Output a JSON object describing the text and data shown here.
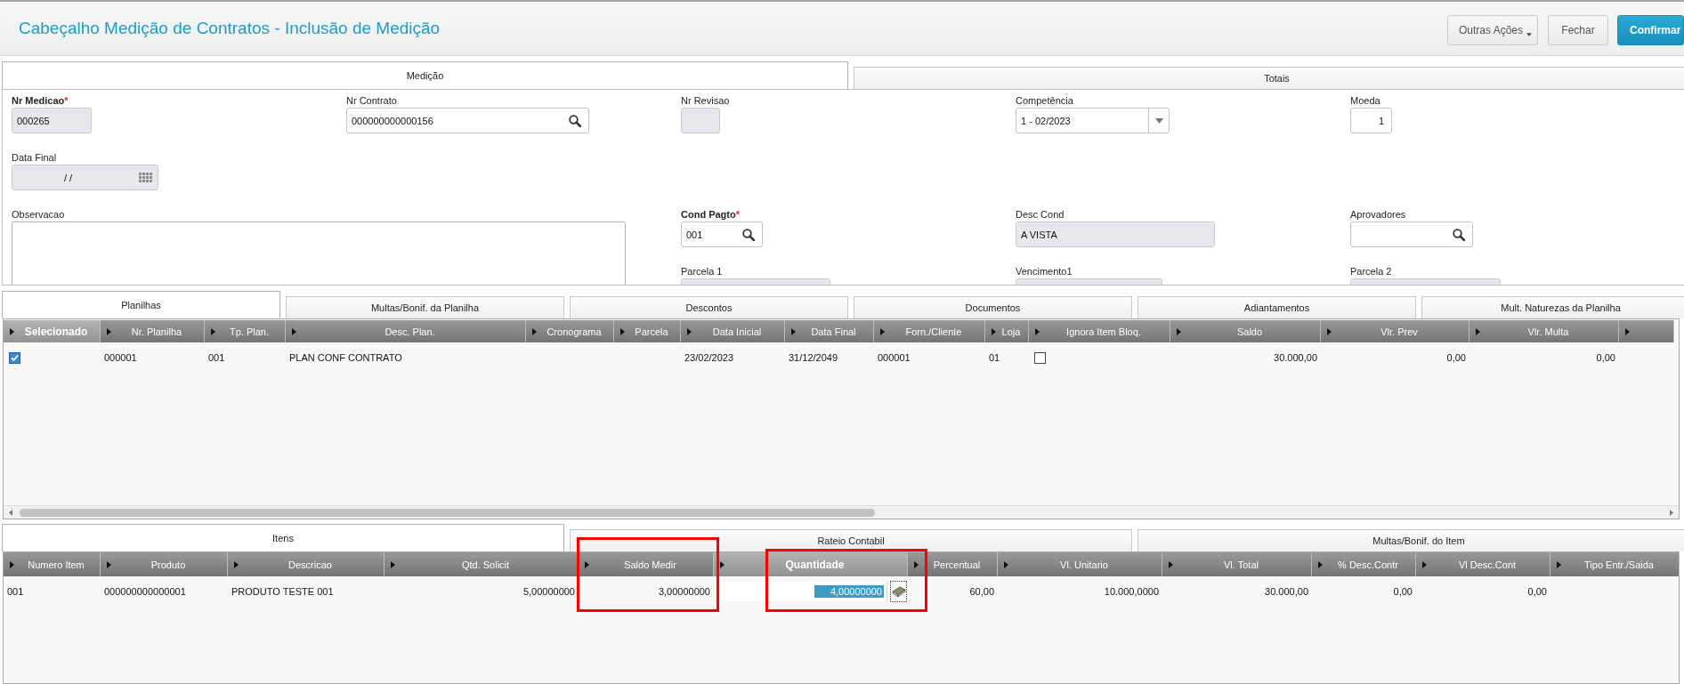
{
  "header": {
    "title": "Cabeçalho Medição de Contratos - Inclusão de Medição",
    "buttons": [
      {
        "label": "Outras Ações",
        "kind": "menu"
      },
      {
        "label": "Fechar",
        "kind": "default"
      },
      {
        "label": "Confirmar",
        "kind": "primary"
      }
    ]
  },
  "form_tabs": [
    {
      "label": "Medição",
      "selected": true
    },
    {
      "label": "Totais",
      "selected": false
    }
  ],
  "form": {
    "fields": [
      {
        "label": "Nr Medicao",
        "required": true,
        "asterisk": "*",
        "kind": "text",
        "value": "000265",
        "disabled": true
      },
      {
        "label": "Nr Contrato",
        "required": false,
        "kind": "lookup",
        "value": "000000000000156",
        "disabled": false
      },
      {
        "label": "Nr Revisao",
        "required": false,
        "kind": "text",
        "disabled": true
      },
      {
        "label": "Competência",
        "required": false,
        "kind": "select",
        "value": "1 - 02/2023",
        "disabled": false
      },
      {
        "label": "Moeda",
        "required": false,
        "kind": "number",
        "value": "1",
        "disabled": false
      },
      {
        "label": "Data Final",
        "required": false,
        "kind": "date",
        "value": "/ /",
        "disabled": true
      },
      {
        "label": "Observacao",
        "required": false,
        "kind": "textarea",
        "disabled": false
      },
      {
        "label": "Cond Pagto",
        "required": true,
        "asterisk": "*",
        "kind": "lookup",
        "value": "001",
        "disabled": false
      },
      {
        "label": "Desc Cond",
        "required": false,
        "kind": "text",
        "value": "A VISTA",
        "disabled": true
      },
      {
        "label": "Aprovadores",
        "required": false,
        "kind": "lookup",
        "disabled": false
      },
      {
        "label": "Parcela 1",
        "required": false,
        "kind": "text",
        "disabled": true
      },
      {
        "label": "Vencimento1",
        "required": false,
        "kind": "text",
        "disabled": true
      },
      {
        "label": "Parcela 2",
        "required": false,
        "kind": "text",
        "disabled": true
      }
    ]
  },
  "grid_tabs": [
    {
      "label": "Planilhas",
      "selected": true
    },
    {
      "label": "Multas/Bonif. da Planilha",
      "selected": false
    },
    {
      "label": "Descontos",
      "selected": false
    },
    {
      "label": "Documentos",
      "selected": false
    },
    {
      "label": "Adiantamentos",
      "selected": false
    },
    {
      "label": "Mult. Naturezas da Planilha",
      "selected": false
    }
  ],
  "planilhas_grid": {
    "columns": [
      {
        "label": "Selecionado",
        "selected": true
      },
      {
        "label": "Nr. Planilha",
        "selected": false
      },
      {
        "label": "Tp. Plan.",
        "selected": false
      },
      {
        "label": "Desc. Plan.",
        "selected": false
      },
      {
        "label": "Cronograma",
        "selected": false
      },
      {
        "label": "Parcela",
        "selected": false
      },
      {
        "label": "Data Inicial",
        "selected": false
      },
      {
        "label": "Data Final",
        "selected": false
      },
      {
        "label": "Forn./Cliente",
        "selected": false
      },
      {
        "label": "Loja",
        "selected": false
      },
      {
        "label": "Ignora Item Bloq.",
        "selected": false
      },
      {
        "label": "Saldo",
        "selected": false
      },
      {
        "label": "Vlr. Prev",
        "selected": false
      },
      {
        "label": "Vlr. Multa",
        "selected": false
      },
      {
        "selected": false
      }
    ],
    "rows": [
      {
        "cells": [
          {
            "kind": "check",
            "checked": true
          },
          {
            "kind": "text",
            "text": "000001"
          },
          {
            "kind": "text",
            "text": "001"
          },
          {
            "kind": "text",
            "text": "PLAN CONF CONTRATO"
          },
          {
            "kind": "blank"
          },
          {
            "kind": "blank"
          },
          {
            "kind": "text",
            "text": "23/02/2023"
          },
          {
            "kind": "text",
            "text": "31/12/2049"
          },
          {
            "kind": "text",
            "text": "000001"
          },
          {
            "kind": "text",
            "text": "01"
          },
          {
            "kind": "check",
            "checked": false
          },
          {
            "kind": "number",
            "text": "30.000,00"
          },
          {
            "kind": "number",
            "text": "0,00"
          },
          {
            "kind": "number",
            "text": "0,00"
          },
          {
            "kind": "blank"
          }
        ]
      }
    ]
  },
  "item_tabs": [
    {
      "label": "Itens",
      "selected": true
    },
    {
      "label": "Rateio Contabil",
      "selected": false
    },
    {
      "label": "Multas/Bonif. do Item",
      "selected": false
    }
  ],
  "itens_grid": {
    "columns": [
      {
        "label": "Numero Item",
        "selected": false,
        "highlighted": false
      },
      {
        "label": "Produto",
        "selected": false,
        "highlighted": false
      },
      {
        "label": "Descricao",
        "selected": false,
        "highlighted": false
      },
      {
        "label": "Qtd. Solicit",
        "selected": false,
        "highlighted": false
      },
      {
        "label": "Saldo Medir",
        "selected": false,
        "highlighted": true
      },
      {
        "label": "Quantidade",
        "selected": true,
        "highlighted": true
      },
      {
        "label": "Percentual",
        "selected": false,
        "highlighted": false
      },
      {
        "label": "Vl. Unitario",
        "selected": false,
        "highlighted": false
      },
      {
        "label": "Vl. Total",
        "selected": false,
        "highlighted": false
      },
      {
        "label": "% Desc.Contr",
        "selected": false,
        "highlighted": false
      },
      {
        "label": "Vl Desc.Cont",
        "selected": false,
        "highlighted": false
      },
      {
        "label": "Tipo Entr./Saida",
        "selected": false,
        "highlighted": false
      }
    ],
    "rows": [
      {
        "cells": [
          {
            "kind": "text",
            "text": "001"
          },
          {
            "kind": "text",
            "text": "000000000000001"
          },
          {
            "kind": "text",
            "text": "PRODUTO TESTE 001"
          },
          {
            "kind": "number",
            "text": "5,00000000"
          },
          {
            "kind": "number",
            "text": "3,00000000"
          },
          {
            "kind": "edit",
            "text": "4,00000000"
          },
          {
            "kind": "number",
            "text": "60,00"
          },
          {
            "kind": "number",
            "text": "10.000,0000"
          },
          {
            "kind": "number",
            "text": "30.000,00"
          },
          {
            "kind": "number",
            "text": "0,00"
          },
          {
            "kind": "number",
            "text": "0,00"
          },
          {
            "kind": "blank"
          }
        ]
      }
    ]
  }
}
